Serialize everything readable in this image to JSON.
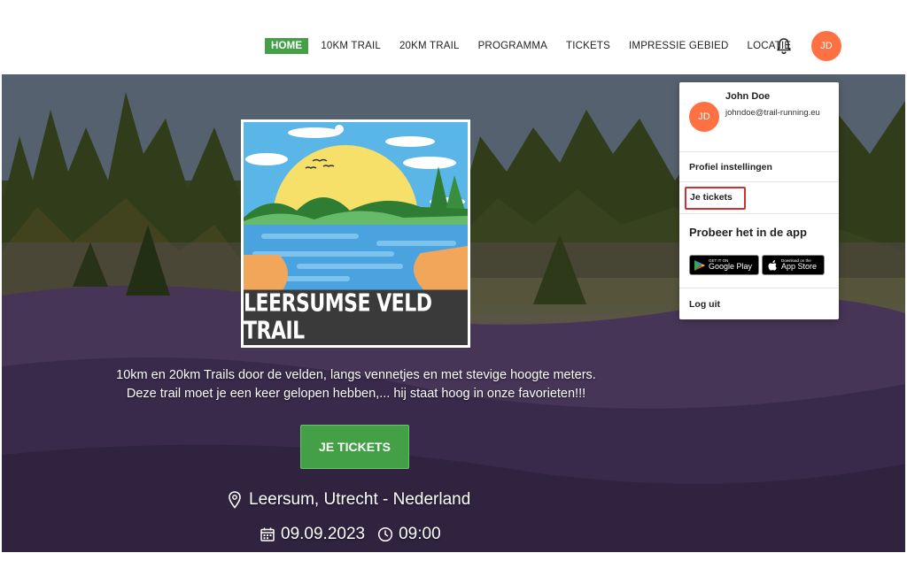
{
  "nav": {
    "items": [
      "HOME",
      "10KM TRAIL",
      "20KM TRAIL",
      "PROGRAMMA",
      "TICKETS",
      "IMPRESSIE GEBIED",
      "LOCATIE"
    ],
    "active": "HOME"
  },
  "header": {
    "avatar_initials": "JD",
    "bell_icon": "bell-icon"
  },
  "hero": {
    "logo_title": "LEERSUMSE VELD TRAIL",
    "description_line1": "10km en 20km Trails door de velden, langs vennetjes en met stevige hoogte meters.",
    "description_line2": "Deze trail moet je een keer gelopen hebben,... hij staat hoog in onze favorieten!!!",
    "cta_label": "JE TICKETS",
    "location": "Leersum, Utrecht - Nederland",
    "date": "09.09.2023",
    "time": "09:00"
  },
  "dropdown": {
    "avatar_initials": "JD",
    "user_name": "John Doe",
    "user_email": "johndoe@trail-running.eu",
    "profile_label": "Profiel instellingen",
    "tickets_label": "Je tickets",
    "app_title": "Probeer het in de app",
    "google_play_small": "GET IT ON",
    "google_play_big": "Google Play",
    "app_store_small": "Download on the",
    "app_store_big": "App Store",
    "logout_label": "Log uit"
  },
  "colors": {
    "accent": "#43a047",
    "avatar": "#ff7043",
    "highlight": "#d32f2f"
  }
}
